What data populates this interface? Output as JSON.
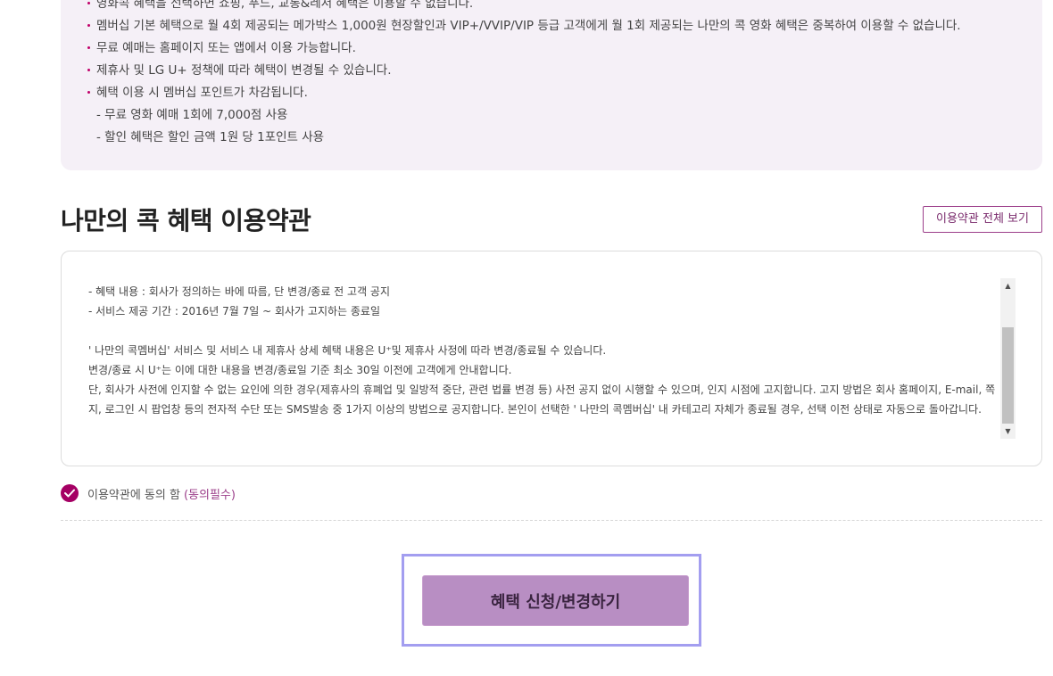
{
  "notice": {
    "items": [
      {
        "type": "bullet",
        "text": "영화콕 혜택을 선택하면 쇼핑, 푸드, 교통&레저 혜택은 이용할 수 없습니다."
      },
      {
        "type": "bullet",
        "text": "멤버십 기본 혜택으로 월 4회 제공되는 메가박스 1,000원 현장할인과 VIP+/VVIP/VIP 등급 고객에게 월 1회 제공되는 나만의 콕 영화 혜택은 중복하여 이용할 수 없습니다."
      },
      {
        "type": "bullet",
        "text": "무료 예매는 홈페이지 또는 앱에서 이용 가능합니다."
      },
      {
        "type": "bullet",
        "text": "제휴사 및 LG U+ 정책에 따라 혜택이 변경될 수 있습니다."
      },
      {
        "type": "bullet",
        "text": "혜택 이용 시 멤버십 포인트가 차감됩니다."
      },
      {
        "type": "sub",
        "text": "- 무료 영화 예매 1회에 7,000점 사용"
      },
      {
        "type": "sub",
        "text": "- 할인 혜택은 할인 금액 1원 당 1포인트 사용"
      }
    ]
  },
  "terms": {
    "title": "나만의 콕 혜택 이용약관",
    "view_all_label": "이용약관 전체 보기",
    "lines": [
      "- 혜택 내용 : 회사가 정의하는 바에 따름, 단 변경/종료 전 고객 공지",
      "- 서비스 제공 기간 : 2016년 7월 7일 ~ 회사가 고지하는 종료일",
      "",
      " ' 나만의 콕멤버십' 서비스 및 서비스 내 제휴사 상세 혜택 내용은 U⁺및 제휴사 사정에 따라 변경/종료될 수 있습니다.",
      "변경/종료 시 U⁺는 이에 대한 내용을 변경/종료일 기준 최소 30일 이전에 고객에게 안내합니다.",
      "단, 회사가 사전에 인지할 수 없는 요인에 의한 경우(제휴사의 휴폐업 및 일방적 중단, 관련 법률 변경 등) 사전 공지 없이 시행할 수 있으며, 인지 시점에 고지합니다. 고지 방법은 회사 홈페이지, E-mail, 쪽지, 로그인 시 팝업창 등의 전자적 수단 또는 SMS발송 중 1가지 이상의 방법으로 공지합니다. 본인이 선택한 ' 나만의 콕멤버십' 내 카테고리 자체가 종료될 경우, 선택 이전 상태로 자동으로 돌아갑니다."
    ]
  },
  "agree": {
    "label": "이용약관에 동의 함",
    "required": "(동의필수)",
    "checked": true,
    "check_color": "#a50064"
  },
  "submit": {
    "label": "혜택 신청/변경하기"
  }
}
